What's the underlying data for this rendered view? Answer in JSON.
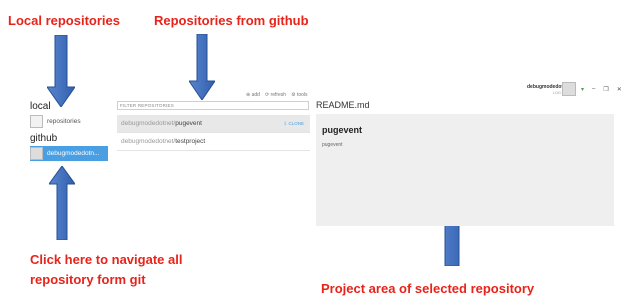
{
  "annotations": {
    "local_repositories": "Local repositories",
    "repositories_from_github": "Repositories from github",
    "click_here": "Click here to navigate all",
    "click_here_line2": "repository form git",
    "project_area": "Project area of selected repository"
  },
  "colors": {
    "annotation_red": "#e8231a",
    "arrow_blue": "#2f5fae",
    "selected_blue": "#4a9ee2"
  },
  "sidebar": {
    "local_heading": "local",
    "local_item": "repositories",
    "github_heading": "github",
    "github_account": "debugmodedotn..."
  },
  "toolbar": {
    "add": "add",
    "refresh": "refresh",
    "tools": "tools"
  },
  "repo_list": {
    "filter_placeholder": "FILTER REPOSITORIES",
    "clone_label": "CLONE",
    "items": [
      {
        "owner": "debugmodedotnet/",
        "name": "pugevent"
      },
      {
        "owner": "debugmodedotnet/",
        "name": "testproject"
      }
    ]
  },
  "window": {
    "username": "debugmodedotnet",
    "logout": "LOG OUT"
  },
  "project": {
    "readme_title": "README.md",
    "repo_name": "pugevent",
    "description": "pugevent"
  }
}
